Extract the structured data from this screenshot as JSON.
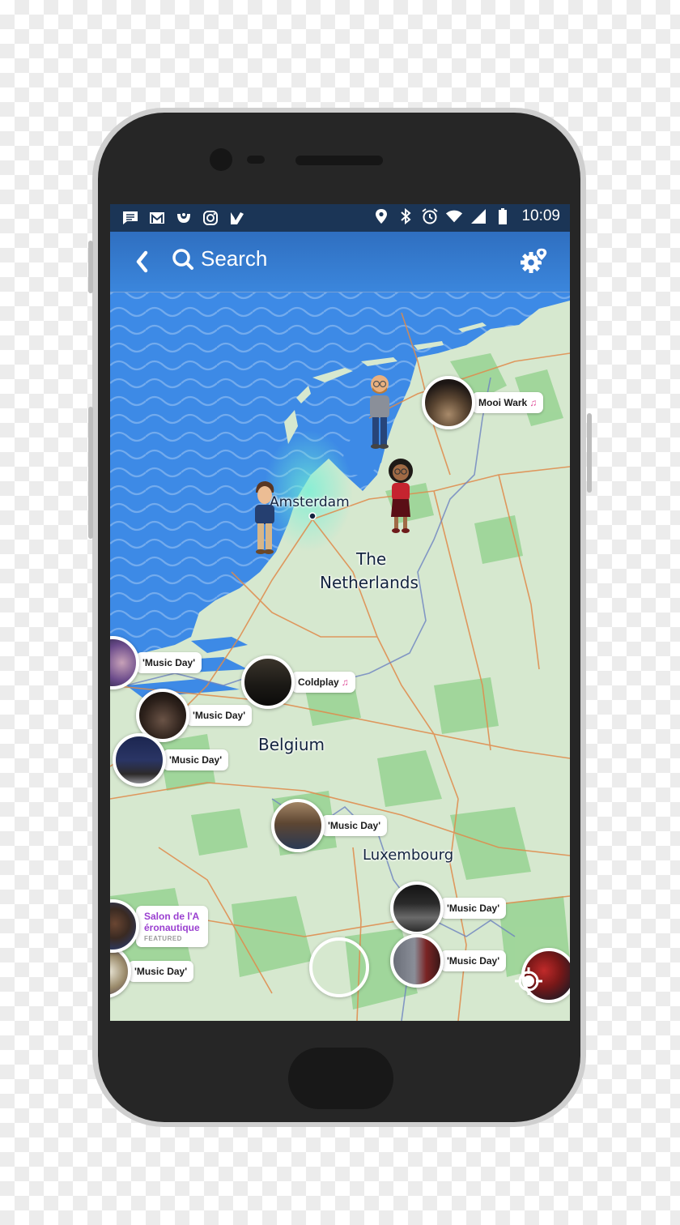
{
  "statusbar": {
    "left_icons": [
      "message-icon",
      "gmail-icon",
      "app-notification-icon",
      "instagram-icon",
      "task-check-icon"
    ],
    "right_icons": [
      "location-icon",
      "bluetooth-icon",
      "alarm-icon",
      "wifi-icon",
      "signal-icon",
      "battery-icon"
    ],
    "time": "10:09"
  },
  "topbar": {
    "back_icon": "chevron-left-icon",
    "search_label": "Search",
    "settings_icon": "map-settings-gear-icon"
  },
  "map": {
    "water_color": "#3d8ae6",
    "land_color": "#d9ead3",
    "places": [
      {
        "name": "Amsterdam",
        "type": "city"
      },
      {
        "name": "The",
        "type": "country"
      },
      {
        "name": "Netherlands",
        "type": "country"
      },
      {
        "name": "Belgium",
        "type": "country"
      },
      {
        "name": "Luxembourg",
        "type": "country"
      }
    ],
    "bitmojis": [
      {
        "id": "friend-bald-glasses"
      },
      {
        "id": "friend-curly-hair-glasses"
      },
      {
        "id": "friend-brown-hair"
      }
    ],
    "stories": [
      {
        "label": "Mooi Wark",
        "music": true
      },
      {
        "label": "'Music Day'",
        "music": false
      },
      {
        "label": "Coldplay",
        "music": true
      },
      {
        "label": "'Music Day'",
        "music": false
      },
      {
        "label": "'Music Day'",
        "music": false
      },
      {
        "label": "'Music Day'",
        "music": false
      },
      {
        "label": "'Music Day'",
        "music": false
      },
      {
        "label": "'Music Day'",
        "music": false
      },
      {
        "label": "'Music Day'",
        "music": false
      }
    ],
    "featured_story": {
      "title_line1": "Salon de l'A",
      "title_line2": "éronautique",
      "badge": "FEATURED"
    },
    "music_note_color": "#e0509a"
  }
}
